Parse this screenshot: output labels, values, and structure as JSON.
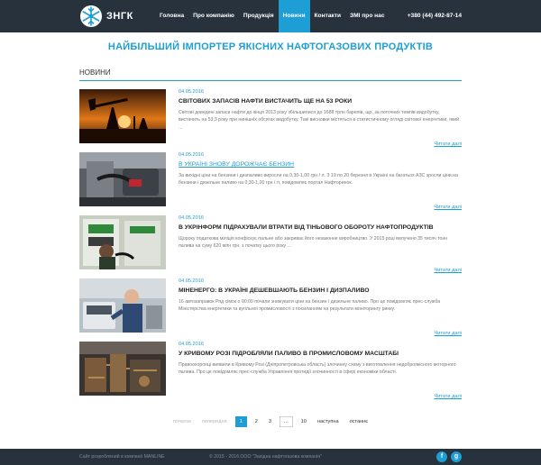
{
  "header": {
    "logo_text": "ЗНГК",
    "nav": [
      "Головна",
      "Про компанію",
      "Продукція",
      "Новини",
      "Контакти",
      "ЗМІ про нас"
    ],
    "active_nav": "Новини",
    "phone": "+380 (44) 492-87-14"
  },
  "headline": "НАЙБІЛЬШИЙ ІМПОРТЕР ЯКІСНИХ НАФТОГАЗОВИХ ПРОДУКТІВ",
  "section_title": "НОВИНИ",
  "news": [
    {
      "date": "04.05.2016",
      "title": "СВІТОВИХ ЗАПАСІВ НАФТИ ВИСТАЧИТЬ ЩЕ НА 53 РОКИ",
      "text": "Світові доведені запаси нафти до кінця 2013 року збільшилися до 1688 трлн барелів, що, за поточних темпів видобутку, вистачить на 53,3 року при нинішніх обсягах видобутку. Такі висновки містяться в статистичному огляді світової енергетики, який ...",
      "read_more": "Читати далі"
    },
    {
      "date": "04.05.2016",
      "title": "В УКРАЇНІ ЗНОВУ ДОРОЖЧАЄ БЕНЗИН",
      "text": "За вихідні ціни на бензини і дизпаливо виросли на 0,30-1,00 грн / л. З 19 по 20 березня в Україні на багатьох АЗС зросли ціни на бензини і дизельне паливо на 0,30-1,00 грн / л, повідомляє портал Нафторинок.",
      "read_more": "Читати далі"
    },
    {
      "date": "04.05.2016",
      "title": "В УКРІНФОРМ ПІДРАХУВАЛИ ВТРАТИ ВІД ТІНЬОВОГО ОБОРОТУ НАФТОПРОДУКТІВ",
      "text": "Щороку податкова міліція конфіскує пальне або закриває його незаконне виробництво. У 2015 році вилучено 35 тисяч тонн палива на суму 620 млн грн, з початку цього року ...",
      "read_more": "Читати далі"
    },
    {
      "date": "04.05.2016",
      "title": "МІНЕНЕРГО: В УКРАЇНІ ДЕШЕВШАЮТЬ БЕНЗИН І ДИЗПАЛИВО",
      "text": "16 автозаправок Ряд сімок о 00:00 почали знижувати ціни на бензин і дизельне паливо. Про це повідомляє прес-служба Міністерства енергетики та вугільної промисловості з посиланням на результати моніторингу ринку.",
      "read_more": "Читати далі"
    },
    {
      "date": "04.05.2016",
      "title": "У КРИВОМУ РОЗІ ПІДРОБЛЯЛИ ПАЛИВО В ПРОМИСЛОВОМУ МАСШТАБІ",
      "text": "Правоохоронці виявили в Кривому Розі (Дніпропетровська область) злочинну схему з виготовлення недоброякісного моторного палива. Про це повідомляє прес-служба Управління протидії злочинності в сфері економіки області.",
      "read_more": "Читати далі"
    }
  ],
  "pagination": {
    "first": "початок",
    "prev": "попередня",
    "pages": [
      "1",
      "2",
      "3"
    ],
    "current": "1",
    "ellipsis": "...",
    "last_page": "10",
    "next": "наступна",
    "end": "останнє"
  },
  "footer": {
    "left": "Сайт розроблений в компанії MANLINE",
    "mid": "© 2015 - 2016 ООО \"Західна нафтогазова компанія\"",
    "social": [
      "facebook-icon",
      "google-plus-icon"
    ]
  },
  "colors": {
    "accent": "#1d9fd6",
    "header_bg": "#28323c"
  }
}
